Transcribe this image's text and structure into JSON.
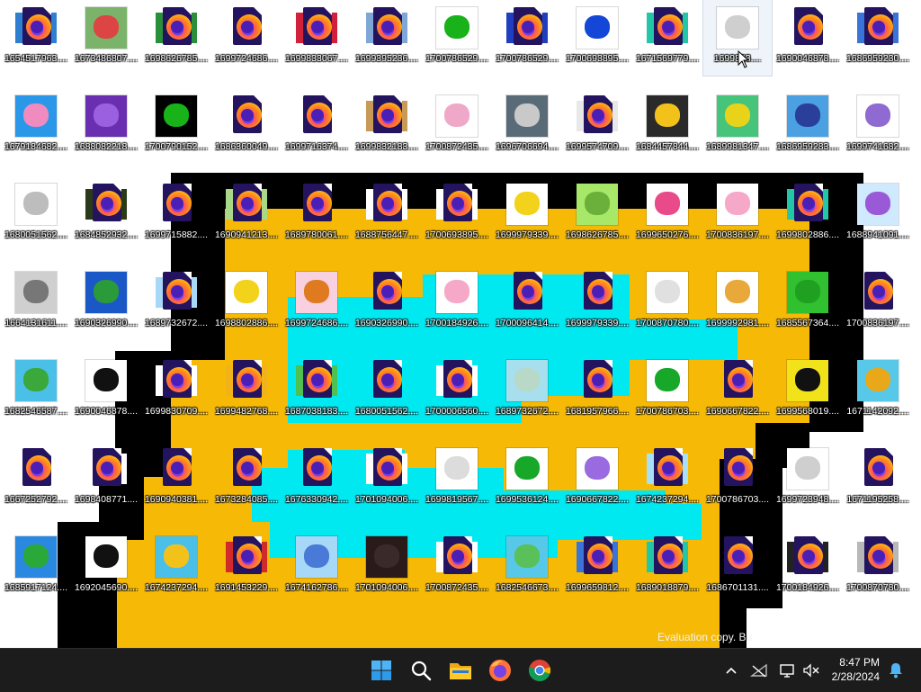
{
  "desktop": {
    "icons": [
      {
        "label": "1654517963....",
        "kind": "ff",
        "bg": "#2f7fd1"
      },
      {
        "label": "1673486807....",
        "kind": "img",
        "bg": "#7bb36a",
        "fg": "#d44"
      },
      {
        "label": "1698626785....",
        "kind": "ff",
        "bg": "#2a8f3a"
      },
      {
        "label": "1699724686....",
        "kind": "ff",
        "bg": null
      },
      {
        "label": "1699833067....",
        "kind": "ff",
        "bg": "#d0203a"
      },
      {
        "label": "1699395236....",
        "kind": "ff",
        "bg": "#7fa7d6"
      },
      {
        "label": "1700786529....",
        "kind": "img",
        "bg": "#ffffff",
        "fg": "#19b21a"
      },
      {
        "label": "1700786529....",
        "kind": "ff",
        "bg": "#1f3fc0"
      },
      {
        "label": "1700693895....",
        "kind": "img",
        "bg": "#ffffff",
        "fg": "#1446d8"
      },
      {
        "label": "1671569779....",
        "kind": "ff",
        "bg": "#21c7a6"
      },
      {
        "label": "1699833....",
        "kind": "img",
        "bg": "#ffffff",
        "fg": "#cfcfcf",
        "selected": true
      },
      {
        "label": "1690046878....",
        "kind": "ff",
        "bg": null
      },
      {
        "label": "1686959230....",
        "kind": "ff",
        "bg": "#3a74d8"
      },
      {
        "label": "1679184682....",
        "kind": "img",
        "bg": "#2a97e8",
        "fg": "#f08bc0"
      },
      {
        "label": "1688082218....",
        "kind": "img",
        "bg": "#6a2fb0",
        "fg": "#9a60e0"
      },
      {
        "label": "1700790152....",
        "kind": "img",
        "bg": "#000000",
        "fg": "#17b318"
      },
      {
        "label": "1686360049....",
        "kind": "ff",
        "bg": null
      },
      {
        "label": "1699716374....",
        "kind": "ff",
        "bg": null
      },
      {
        "label": "1699832183....",
        "kind": "ff",
        "bg": "#c89a58"
      },
      {
        "label": "1700872435....",
        "kind": "img",
        "bg": "#ffffff",
        "fg": "#f0a8c8"
      },
      {
        "label": "1696706694....",
        "kind": "img",
        "bg": "#5a6b78",
        "fg": "#c9c9c9"
      },
      {
        "label": "1699574709....",
        "kind": "ff",
        "bg": "#e8e8e8"
      },
      {
        "label": "1684457844....",
        "kind": "img",
        "bg": "#2a2a2a",
        "fg": "#f2c21a"
      },
      {
        "label": "1689981347....",
        "kind": "img",
        "bg": "#46c47a",
        "fg": "#e8d21a"
      },
      {
        "label": "1686959283....",
        "kind": "img",
        "bg": "#4aa0e0",
        "fg": "#2a3f9a"
      },
      {
        "label": "1699741682....",
        "kind": "img",
        "bg": "#ffffff",
        "fg": "#8f6ad0"
      },
      {
        "label": "1680051562....",
        "kind": "img",
        "bg": "#ffffff",
        "fg": "#bdbdbd"
      },
      {
        "label": "1684852932....",
        "kind": "ff",
        "bg": "#2a3a18"
      },
      {
        "label": "1699715882....",
        "kind": "ff",
        "bg": null
      },
      {
        "label": "1690941213....",
        "kind": "ff",
        "bg": "#a8d888"
      },
      {
        "label": "1689780061....",
        "kind": "ff",
        "bg": null
      },
      {
        "label": "1688756447....",
        "kind": "ff",
        "bg": "#ffffff"
      },
      {
        "label": "1700693895....",
        "kind": "ff",
        "bg": "#ffffff"
      },
      {
        "label": "1699979339....",
        "kind": "img",
        "bg": "#ffffff",
        "fg": "#f2d21a"
      },
      {
        "label": "1698626785....",
        "kind": "img",
        "bg": "#a8e868",
        "fg": "#6ab03a"
      },
      {
        "label": "1699650276....",
        "kind": "img",
        "bg": "#ffffff",
        "fg": "#e84a8a"
      },
      {
        "label": "1700836197....",
        "kind": "img",
        "bg": "#ffffff",
        "fg": "#f5a8c8"
      },
      {
        "label": "1699802886....",
        "kind": "ff",
        "bg": "#21c7a6"
      },
      {
        "label": "1688941091....",
        "kind": "img",
        "bg": "#cfe9ff",
        "fg": "#9a5ad8"
      },
      {
        "label": "1664131611....",
        "kind": "img",
        "bg": "#cfcfcf",
        "fg": "#777777"
      },
      {
        "label": "1690326990....",
        "kind": "img",
        "bg": "#1a58c8",
        "fg": "#2a9a3a"
      },
      {
        "label": "1689732672....",
        "kind": "ff",
        "bg": "#a8d8f8"
      },
      {
        "label": "1698802886....",
        "kind": "img",
        "bg": "#ffffff",
        "fg": "#f2d21a"
      },
      {
        "label": "1699724686....",
        "kind": "img",
        "bg": "#f8d0e0",
        "fg": "#e07a20"
      },
      {
        "label": "1690326990....",
        "kind": "ff",
        "bg": null
      },
      {
        "label": "1700184926....",
        "kind": "img",
        "bg": "#ffffff",
        "fg": "#f5a8c8"
      },
      {
        "label": "1700096414....",
        "kind": "ff",
        "bg": null
      },
      {
        "label": "1699979339....",
        "kind": "ff",
        "bg": null
      },
      {
        "label": "1700870780....",
        "kind": "img",
        "bg": "#ffffff",
        "fg": "#e0e0e0"
      },
      {
        "label": "1699992981....",
        "kind": "img",
        "bg": "#ffffff",
        "fg": "#e8a83a"
      },
      {
        "label": "1685567364....",
        "kind": "img",
        "bg": "#30c030",
        "fg": "#20a020"
      },
      {
        "label": "1700836197....",
        "kind": "ff",
        "bg": null
      },
      {
        "label": "1682546587....",
        "kind": "img",
        "bg": "#4ac0e8",
        "fg": "#3aa83a"
      },
      {
        "label": "1690046878....",
        "kind": "img",
        "bg": "#ffffff",
        "fg": "#111111"
      },
      {
        "label": "1699830709....",
        "kind": "ff",
        "bg": "#ffffff"
      },
      {
        "label": "1699482768....",
        "kind": "ff",
        "bg": "#f2b21a"
      },
      {
        "label": "1687038183....",
        "kind": "ff",
        "bg": "#50c050"
      },
      {
        "label": "1680051562....",
        "kind": "ff",
        "bg": null
      },
      {
        "label": "1700006560....",
        "kind": "ff",
        "bg": "#ffffff"
      },
      {
        "label": "1689732672....",
        "kind": "img",
        "bg": "#a8dfee",
        "fg": "#b8d8c8"
      },
      {
        "label": "1681957966....",
        "kind": "ff",
        "bg": null
      },
      {
        "label": "1700786703....",
        "kind": "img",
        "bg": "#ffffff",
        "fg": "#17a82a"
      },
      {
        "label": "1690667822....",
        "kind": "ff",
        "bg": null
      },
      {
        "label": "1699568019....",
        "kind": "img",
        "bg": "#f2e21a",
        "fg": "#111111"
      },
      {
        "label": "1671142092....",
        "kind": "img",
        "bg": "#58c8e8",
        "fg": "#e8a81a"
      },
      {
        "label": "1667252792....",
        "kind": "ff",
        "bg": null
      },
      {
        "label": "1698408771....",
        "kind": "ff",
        "bg": "#ffffff"
      },
      {
        "label": "1690940381....",
        "kind": "ff",
        "bg": null
      },
      {
        "label": "1673284085....",
        "kind": "ff",
        "bg": null
      },
      {
        "label": "1676330942....",
        "kind": "ff",
        "bg": null
      },
      {
        "label": "1701094006....",
        "kind": "ff",
        "bg": "#ffffff"
      },
      {
        "label": "1699819567....",
        "kind": "img",
        "bg": "#ffffff",
        "fg": "#dcdcdc"
      },
      {
        "label": "1699536124....",
        "kind": "img",
        "bg": "#ffffff",
        "fg": "#17a82a"
      },
      {
        "label": "1690667822....",
        "kind": "img",
        "bg": "#ffffff",
        "fg": "#9a6ae0"
      },
      {
        "label": "1674237294....",
        "kind": "ff",
        "bg": "#a8e0f8"
      },
      {
        "label": "1700786703....",
        "kind": "ff",
        "bg": null
      },
      {
        "label": "1699723948....",
        "kind": "img",
        "bg": "#ffffff",
        "fg": "#cfcfcf"
      },
      {
        "label": "1671195258....",
        "kind": "ff",
        "bg": null
      },
      {
        "label": "1685917124....",
        "kind": "img",
        "bg": "#2a88e0",
        "fg": "#2aa83a"
      },
      {
        "label": "1692045690....",
        "kind": "img",
        "bg": "#ffffff",
        "fg": "#111111"
      },
      {
        "label": "1674237294....",
        "kind": "img",
        "bg": "#4ac0e8",
        "fg": "#f2c21a"
      },
      {
        "label": "1691453229....",
        "kind": "ff",
        "bg": "#d02a2a"
      },
      {
        "label": "1674162786....",
        "kind": "img",
        "bg": "#a8d8f8",
        "fg": "#4a7ad8"
      },
      {
        "label": "1701094006....",
        "kind": "img",
        "bg": "#2a1a1a",
        "fg": "#3a2a2a"
      },
      {
        "label": "1700872435....",
        "kind": "ff",
        "bg": "#ffffff"
      },
      {
        "label": "1682546673....",
        "kind": "img",
        "bg": "#58c8e8",
        "fg": "#5ac05a"
      },
      {
        "label": "1699659812....",
        "kind": "ff",
        "bg": "#3a74d8"
      },
      {
        "label": "1689018879....",
        "kind": "ff",
        "bg": "#21c7a6"
      },
      {
        "label": "1686701131....",
        "kind": "ff",
        "bg": null
      },
      {
        "label": "1700184926....",
        "kind": "ff",
        "bg": "#222222"
      },
      {
        "label": "1700870780....",
        "kind": "ff",
        "bg": "#b8b8b8"
      }
    ]
  },
  "watermark": "Evaluation copy. Bu",
  "taskbar": {
    "apps": [
      {
        "name": "start-button",
        "icon": "windows-logo-icon"
      },
      {
        "name": "search-button",
        "icon": "search-icon"
      },
      {
        "name": "file-explorer-button",
        "icon": "folder-icon"
      },
      {
        "name": "firefox-button",
        "icon": "firefox-icon"
      },
      {
        "name": "chrome-button",
        "icon": "chrome-icon"
      }
    ],
    "tray": [
      "chevron-up-icon",
      "network-off-icon",
      "display-icon",
      "speaker-muted-icon"
    ],
    "clock": {
      "time": "8:47 PM",
      "date": "2/28/2024"
    },
    "notification_icon": "bell-icon"
  },
  "colors": {
    "taskbar_bg": "#1c1c1c",
    "wallpaper_orange": "#f6ba06",
    "wallpaper_cyan": "#00e8f0",
    "wallpaper_black": "#000000"
  }
}
